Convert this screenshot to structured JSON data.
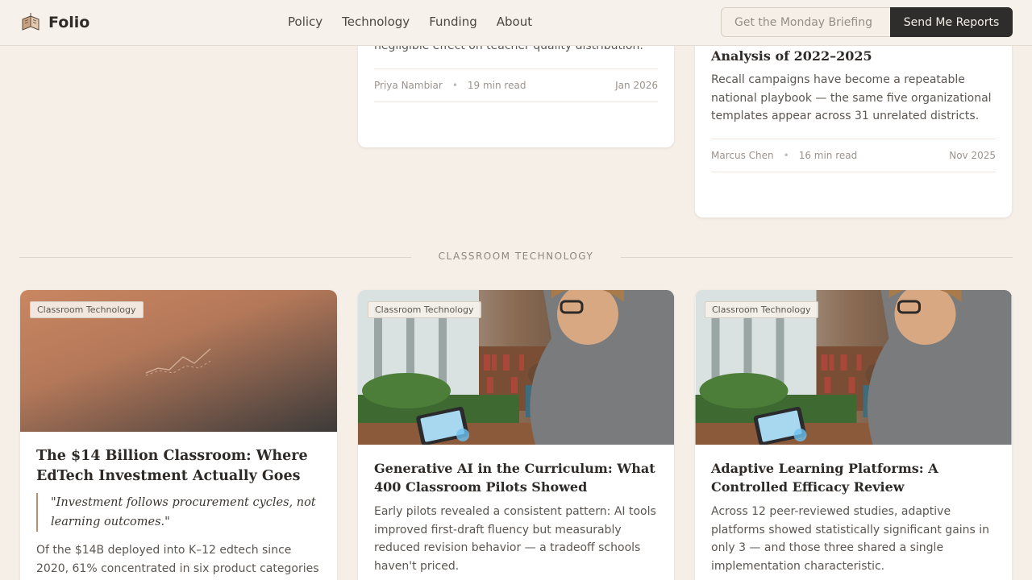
{
  "header": {
    "brand": "Folio",
    "nav": [
      "Policy",
      "Technology",
      "Funding",
      "About"
    ],
    "subscribe_placeholder": "Get the Monday Briefing",
    "subscribe_button": "Send Me Reports"
  },
  "top_cards": [
    {
      "text_tail": "negligible effect on teacher quality distribution.",
      "author": "Priya Nambiar",
      "read_time": "19 min read",
      "date": "Jan 2026"
    },
    {
      "title_tail": "Analysis of 2022–2025",
      "text": "Recall campaigns have become a repeatable national playbook — the same five organizational templates appear across 31 unrelated districts.",
      "author": "Marcus Chen",
      "read_time": "16 min read",
      "date": "Nov 2025"
    }
  ],
  "section": {
    "label": "CLASSROOM TECHNOLOGY"
  },
  "cards": [
    {
      "tag": "Classroom Technology",
      "title": "The $14 Billion Classroom: Where EdTech Investment Actually Goes",
      "quote": "\"Investment follows procurement cycles, not learning outcomes.\"",
      "text": "Of the $14B deployed into K–12 edtech since 2020, 61% concentrated in six product categories"
    },
    {
      "tag": "Classroom Technology",
      "title": "Generative AI in the Curriculum: What 400 Classroom Pilots Showed",
      "text": "Early pilots revealed a consistent pattern: AI tools improved first-draft fluency but measurably reduced revision behavior — a tradeoff schools haven't priced."
    },
    {
      "tag": "Classroom Technology",
      "title": "Adaptive Learning Platforms: A Controlled Efficacy Review",
      "text": "Across 12 peer-reviewed studies, adaptive platforms showed statistically significant gains in only 3 — and those three shared a single implementation characteristic."
    }
  ],
  "colors": {
    "background": "#f5efe8",
    "accent": "#c58a6a",
    "button": "#2f2d2b"
  }
}
